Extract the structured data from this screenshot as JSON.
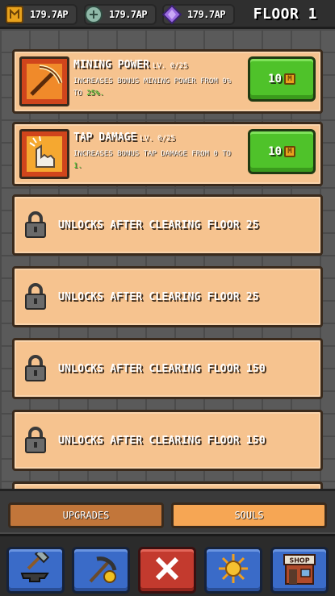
{
  "topbar": {
    "resources": [
      {
        "icon": "gold-coin-icon",
        "value": "179.7AP"
      },
      {
        "icon": "soul-stone-icon",
        "value": "179.7AP"
      },
      {
        "icon": "purple-gem-icon",
        "value": "179.7AP"
      }
    ],
    "floor_label": "FLOOR 1"
  },
  "upgrades": [
    {
      "icon": "pickaxe-icon",
      "title": "MINING POWER",
      "level": "LV. 0/25",
      "desc_prefix": "INCREASES BONUS MINING POWER FROM 0% TO ",
      "desc_highlight": "25%.",
      "cost": "10",
      "cost_icon": "gold-coin-icon"
    },
    {
      "icon": "tap-hand-icon",
      "title": "TAP DAMAGE",
      "level": "LV. 0/25",
      "desc_prefix": "INCREASES BONUS TAP DAMAGE FROM 0 TO ",
      "desc_highlight": "1.",
      "cost": "10",
      "cost_icon": "gold-coin-icon"
    }
  ],
  "locked": [
    {
      "label": "UNLOCKS AFTER CLEARING FLOOR 25"
    },
    {
      "label": "UNLOCKS AFTER CLEARING FLOOR 25"
    },
    {
      "label": "UNLOCKS AFTER CLEARING FLOOR 150"
    },
    {
      "label": "UNLOCKS AFTER CLEARING FLOOR 150"
    }
  ],
  "tabs": {
    "upgrades": "UPGRADES",
    "souls": "SOULS",
    "active": "upgrades"
  },
  "nav": [
    {
      "icon": "anvil-hammer-icon",
      "color": "#3a6bc8"
    },
    {
      "icon": "pickaxe-gold-icon",
      "color": "#3a6bc8"
    },
    {
      "icon": "close-x-icon",
      "color": "#c33a2e"
    },
    {
      "icon": "sun-emblem-icon",
      "color": "#3a6bc8"
    },
    {
      "icon": "shop-icon",
      "label": "SHOP",
      "color": "#3a6bc8"
    }
  ],
  "colors": {
    "card": "#f6c38f",
    "buy_button": "#4fc22a",
    "highlight": "#3fcf2f"
  }
}
